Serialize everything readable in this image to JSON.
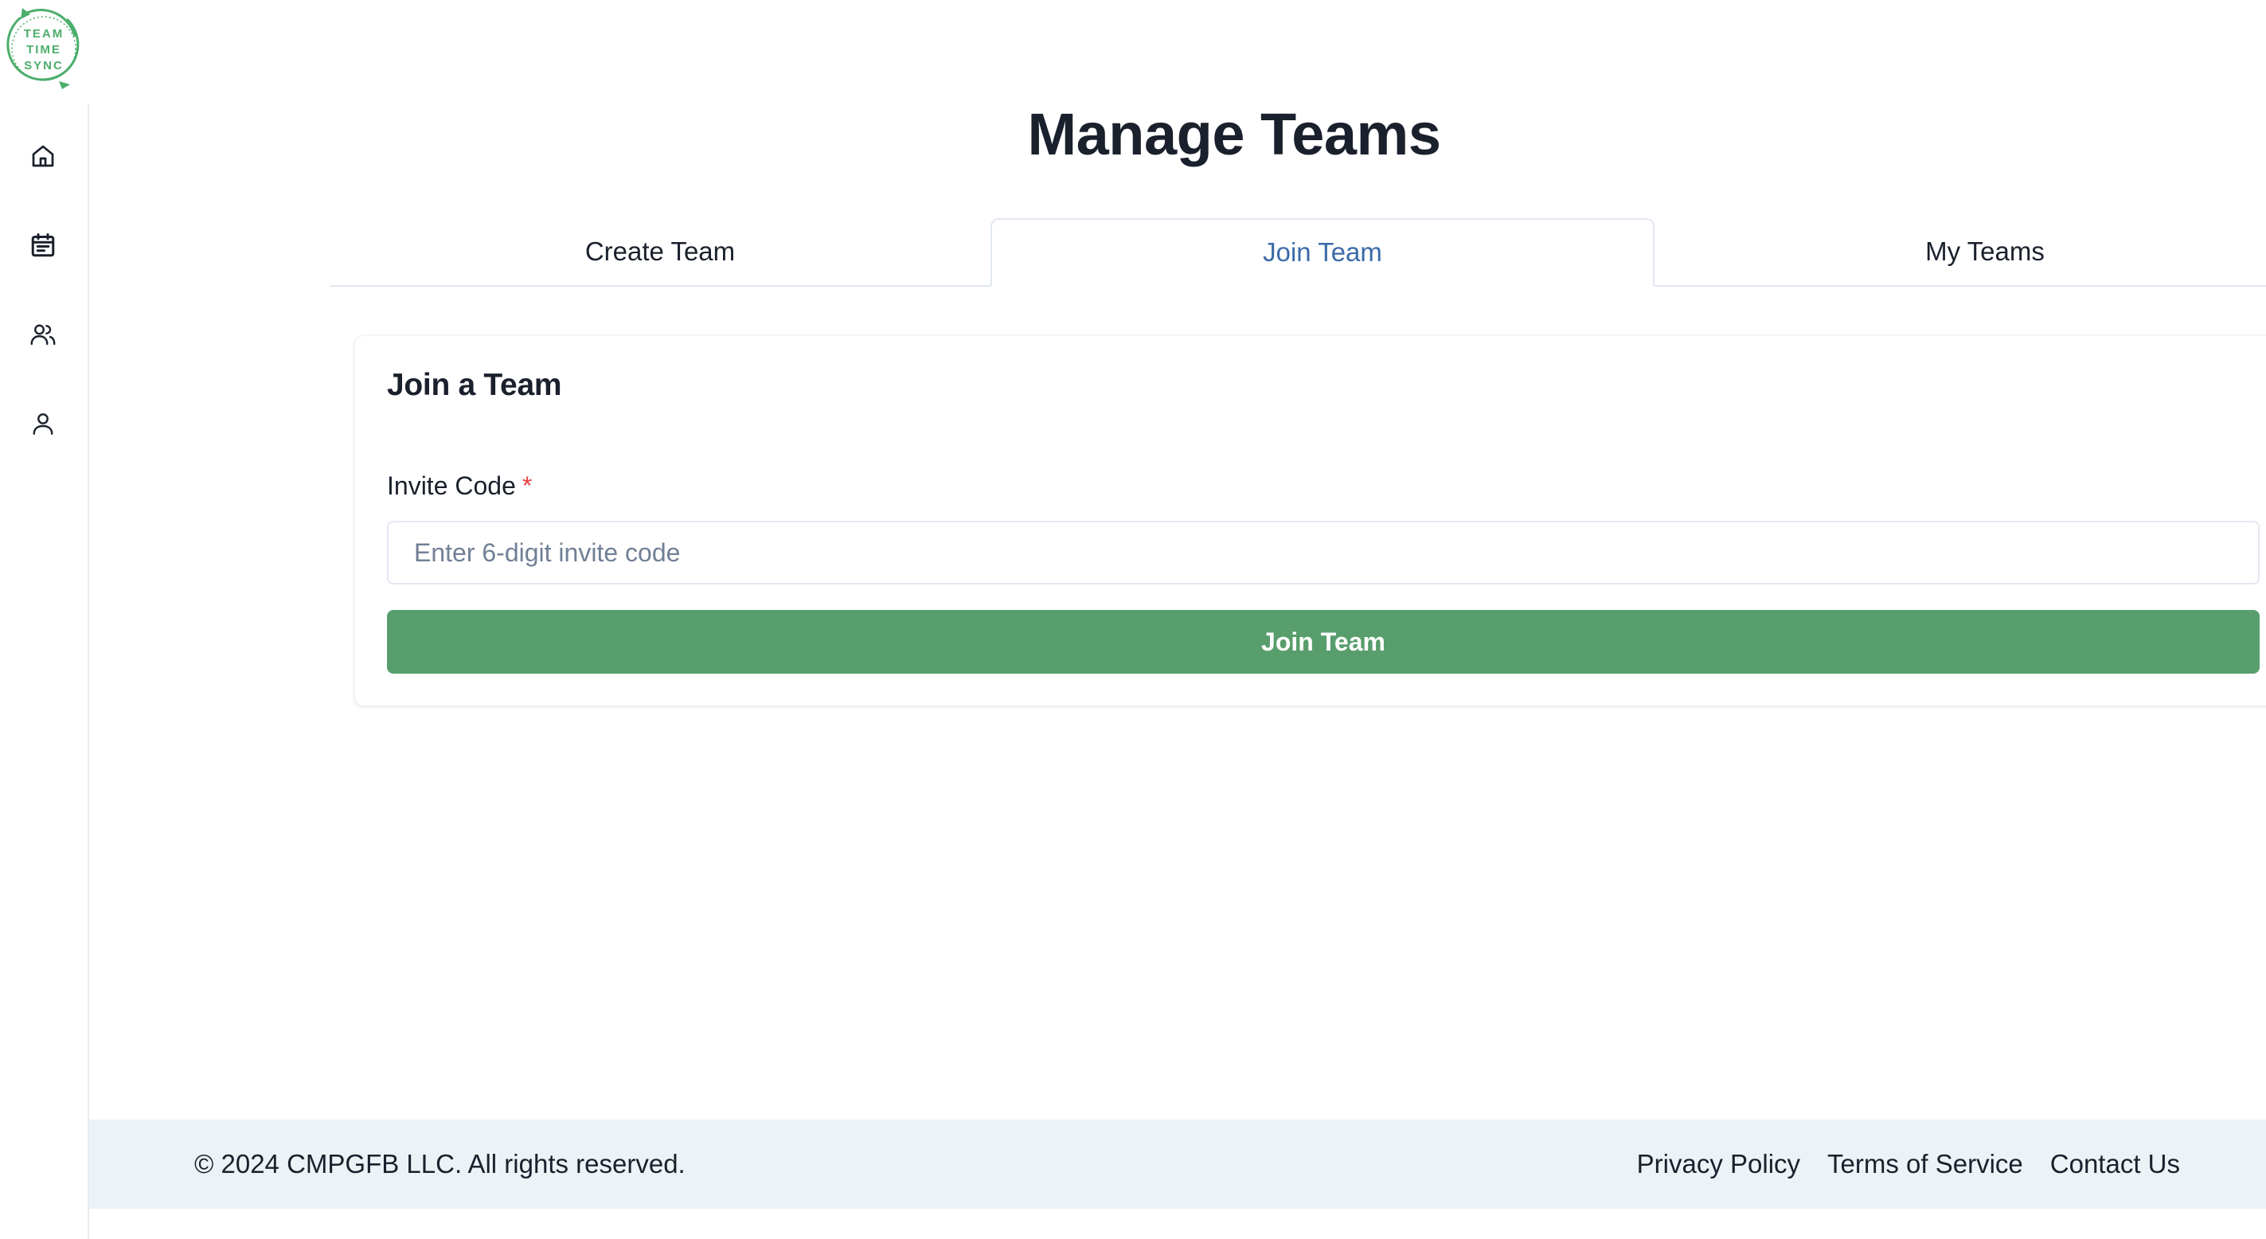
{
  "app": {
    "logo_lines": [
      "TEAM",
      "TIME",
      "SYNC"
    ],
    "brand_color": "#4cae6b"
  },
  "sidebar": {
    "items": [
      {
        "name": "home",
        "icon": "home-icon"
      },
      {
        "name": "calendar",
        "icon": "calendar-icon"
      },
      {
        "name": "teams",
        "icon": "users-icon"
      },
      {
        "name": "profile",
        "icon": "user-icon"
      }
    ]
  },
  "header": {
    "title": "Manage Teams"
  },
  "tabs": [
    {
      "label": "Create Team",
      "active": false
    },
    {
      "label": "Join Team",
      "active": true
    },
    {
      "label": "My Teams",
      "active": false
    }
  ],
  "join_card": {
    "title": "Join a Team",
    "field_label": "Invite Code",
    "required_mark": "*",
    "input_value": "",
    "input_placeholder": "Enter 6-digit invite code",
    "submit_label": "Join Team"
  },
  "colors": {
    "active_tab": "#3b6aa8",
    "button": "#589e6d",
    "required": "#e53e3e",
    "footer_bg": "#edf2f7"
  },
  "footer": {
    "copyright": "© 2024 CMPGFB LLC. All rights reserved.",
    "links": [
      "Privacy Policy",
      "Terms of Service",
      "Contact Us"
    ]
  }
}
